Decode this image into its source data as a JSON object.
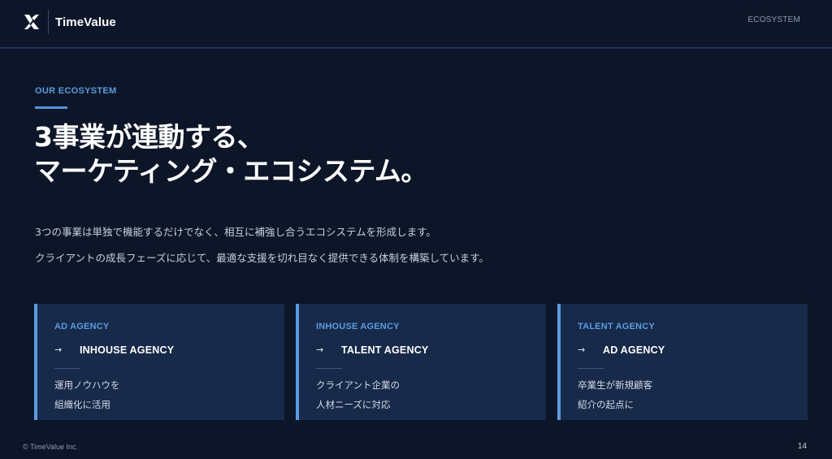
{
  "header": {
    "brand_name": "TimeValue",
    "logo_icon": "timevalue-x-logo",
    "nav_label": "ECOSYSTEM"
  },
  "hero": {
    "kicker": "OUR ECOSYSTEM",
    "headline_line1": "3事業が連動する、",
    "headline_line2": "マーケティング・エコシステム。",
    "lead_line1": "3つの事業は単独で機能するだけでなく、相互に補強し合うエコシステムを形成します。",
    "lead_line2": "クライアントの成長フェーズに応じて、最適な支援を切れ目なく提供できる体制を構築しています。"
  },
  "cards": [
    {
      "label": "AD AGENCY",
      "arrow": "→",
      "target": "INHOUSE AGENCY",
      "desc_line1": "運用ノウハウを",
      "desc_line2": "組織化に活用"
    },
    {
      "label": "INHOUSE AGENCY",
      "arrow": "→",
      "target": "TALENT AGENCY",
      "desc_line1": "クライアント企業の",
      "desc_line2": "人材ニーズに対応"
    },
    {
      "label": "TALENT AGENCY",
      "arrow": "→",
      "target": "AD AGENCY",
      "desc_line1": "卒業生が新規顧客",
      "desc_line2": "紹介の起点に"
    }
  ],
  "footer": {
    "copyright": "© TimeValue Inc.",
    "page_number": "14"
  },
  "colors": {
    "background": "#0c1628",
    "card_background": "#172a4a",
    "accent": "#5b9be0",
    "text_primary": "#ffffff",
    "text_muted": "#8d9bb0"
  }
}
